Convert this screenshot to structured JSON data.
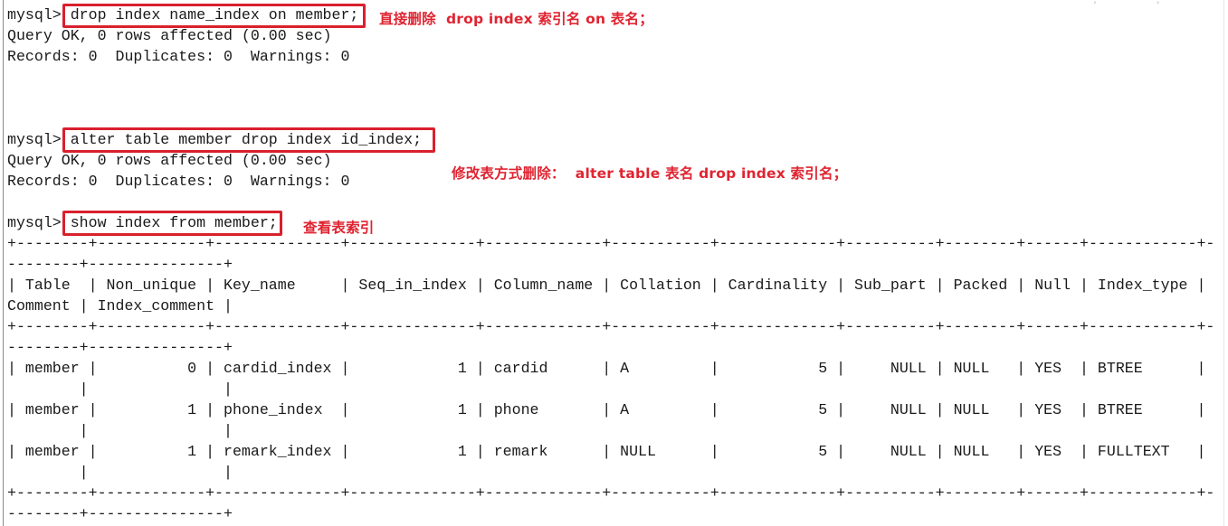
{
  "terminal": {
    "prompt": "mysql> ",
    "blocks": [
      {
        "command": "drop index name_index on member;",
        "output": [
          "Query OK, 0 rows affected (0.00 sec)",
          "Records: 0  Duplicates: 0  Warnings: 0"
        ],
        "annotation": "直接删除  drop index 索引名 on 表名；"
      },
      {
        "command": "alter table member drop index id_index;",
        "output": [
          "Query OK, 0 rows affected (0.00 sec)",
          "Records: 0  Duplicates: 0  Warnings: 0"
        ],
        "annotation": "修改表方式删除：  alter table 表名 drop index 索引名；"
      },
      {
        "command": "show index from member;",
        "annotation": "查看表索引"
      }
    ],
    "table": {
      "columns": [
        "Table",
        "Non_unique",
        "Key_name",
        "Seq_in_index",
        "Column_name",
        "Collation",
        "Cardinality",
        "Sub_part",
        "Packed",
        "Null",
        "Index_type",
        "Comment",
        "Index_comment"
      ],
      "rows": [
        [
          "member",
          "0",
          "cardid_index",
          "1",
          "cardid",
          "A",
          "5",
          "NULL",
          "NULL",
          "YES",
          "BTREE",
          "",
          ""
        ],
        [
          "member",
          "1",
          "phone_index",
          "1",
          "phone",
          "A",
          "5",
          "NULL",
          "NULL",
          "YES",
          "BTREE",
          "",
          ""
        ],
        [
          "member",
          "1",
          "remark_index",
          "1",
          "remark",
          "NULL",
          "5",
          "NULL",
          "NULL",
          "YES",
          "FULLTEXT",
          "",
          ""
        ]
      ]
    }
  },
  "colors": {
    "annotation_red": "#e02431",
    "box_red": "#d9202d",
    "text": "#1a1a1a",
    "background": "#ffffff"
  }
}
